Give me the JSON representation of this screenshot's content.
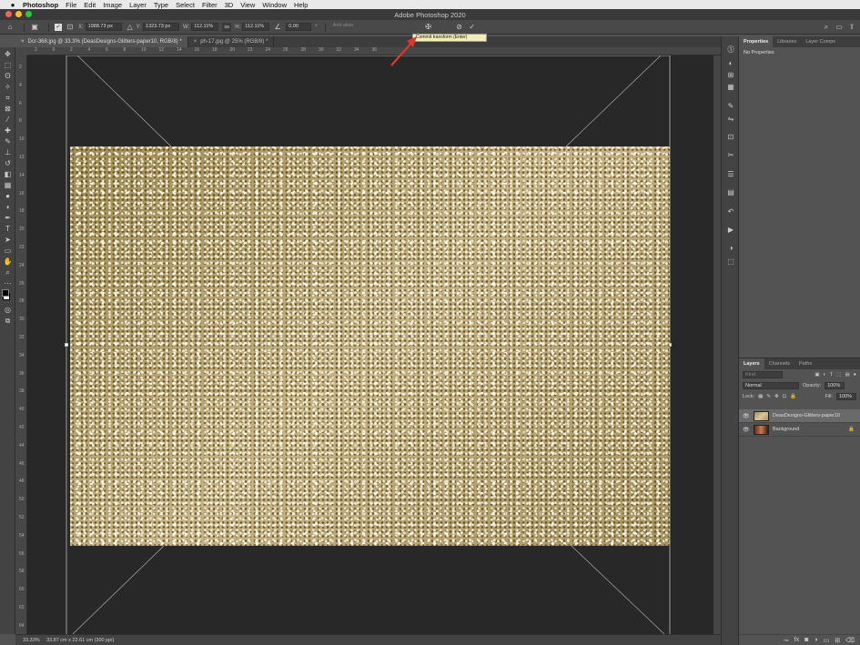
{
  "menubar": {
    "apple": "",
    "items": [
      "Photoshop",
      "File",
      "Edit",
      "Image",
      "Layer",
      "Type",
      "Select",
      "Filter",
      "3D",
      "View",
      "Window",
      "Help"
    ]
  },
  "window": {
    "title": "Adobe Photoshop 2020"
  },
  "options_bar": {
    "x_label": "X:",
    "x_value": "1988.73 px",
    "y_label": "Y:",
    "y_value": "1323.73 px",
    "w_label": "W:",
    "w_value": "112.11%",
    "h_label": "H:",
    "h_value": "112.11%",
    "angle_value": "0.00",
    "angle_unit": "°",
    "interp_placeholder": "Anti-alias",
    "cancel_icon": "cancel-transform-icon",
    "commit_icon": "commit-transform-checkmark-icon"
  },
  "tooltip": {
    "text": "Commit transform (Enter)"
  },
  "tabs": [
    {
      "label": "Dcr-368.jpg @ 33.3% (DeasDesigns-Glitters-paper10, RGB/8) *",
      "active": true
    },
    {
      "label": "ph-17.jpg @ 25% (RGB/8) *",
      "active": false
    }
  ],
  "hruler": {
    "ticks": [
      "2",
      "0",
      "2",
      "4",
      "6",
      "8",
      "10",
      "12",
      "14",
      "16",
      "18",
      "20",
      "22",
      "24",
      "26",
      "28",
      "30",
      "32",
      "34",
      "36"
    ]
  },
  "vruler": {
    "ticks": [
      "2",
      "4",
      "6",
      "8",
      "10",
      "12",
      "14",
      "16",
      "18",
      "20",
      "22",
      "24",
      "26",
      "28",
      "30",
      "32",
      "34",
      "36",
      "38",
      "40",
      "42",
      "44",
      "46",
      "48",
      "50",
      "52",
      "54",
      "56",
      "58",
      "60",
      "62",
      "64"
    ]
  },
  "status": {
    "zoom": "33.33%",
    "doc_info": "33.87 cm x 22.61 cm (300 ppi)"
  },
  "properties_panel": {
    "tabs": [
      "Properties",
      "Libraries",
      "Layer Comps"
    ],
    "body_text": "No Properties"
  },
  "layers_panel": {
    "tabs": [
      "Layers",
      "Channels",
      "Paths"
    ],
    "filter_placeholder": "Kind",
    "blend_mode": "Normal",
    "opacity_label": "Opacity:",
    "opacity_value": "100%",
    "lock_label": "Lock:",
    "fill_label": "Fill:",
    "fill_value": "100%",
    "layers": [
      {
        "name": "DeasDesigns-Glitters-paper10",
        "selected": true,
        "visible": true,
        "locked": false
      },
      {
        "name": "Background",
        "selected": false,
        "visible": true,
        "locked": true
      }
    ],
    "footer_icons": [
      "link-icon",
      "fx-icon",
      "mask-icon",
      "adjustment-icon",
      "group-icon",
      "new-layer-icon",
      "trash-icon"
    ]
  },
  "colors": {
    "accent_arrow": "#e0352b",
    "tooltip_bg": "#f2eeb9",
    "glitter_gold": "#b9a675"
  }
}
